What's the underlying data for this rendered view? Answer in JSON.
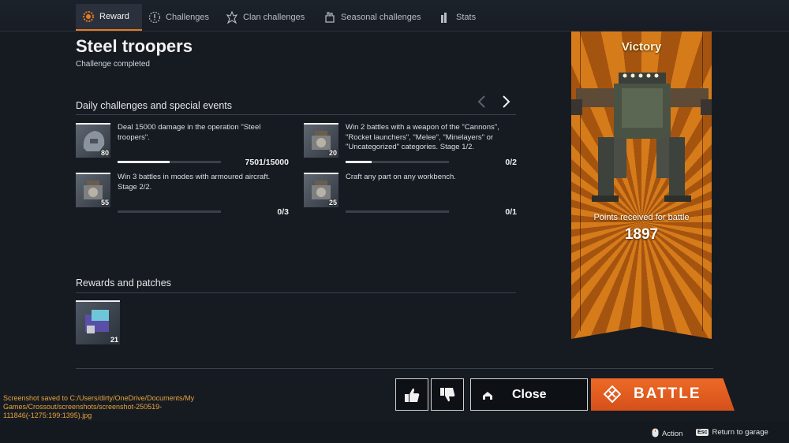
{
  "tabs": [
    {
      "label": "Reward",
      "icon": "gear-badge-icon",
      "active": true
    },
    {
      "label": "Challenges",
      "icon": "challenge-circle-icon",
      "active": false
    },
    {
      "label": "Clan challenges",
      "icon": "clan-flame-icon",
      "active": false
    },
    {
      "label": "Seasonal challenges",
      "icon": "seasonal-hand-icon",
      "active": false
    },
    {
      "label": "Stats",
      "icon": "stats-flag-icon",
      "active": false
    }
  ],
  "header": {
    "title": "Steel troopers",
    "subtitle": "Challenge completed"
  },
  "daily": {
    "heading": "Daily challenges and special events",
    "challenges": [
      {
        "text": "Deal 15000 damage in the operation \"Steel troopers\".",
        "count": "80",
        "progress": "7501/15000",
        "fraction": 0.5,
        "icon": "helmet-icon"
      },
      {
        "text": "Win 2 battles with a weapon of the \"Cannons\", \"Rocket launchers\", \"Melee\", \"Minelayers\" or \"Uncategorized\" categories. Stage 1/2.",
        "count": "20",
        "progress": "0/2",
        "fraction": 0.25,
        "icon": "scrap-crate-icon"
      },
      {
        "text": "Win 3 battles in modes with armoured aircraft. Stage 2/2.",
        "count": "55",
        "progress": "0/3",
        "fraction": 0,
        "icon": "scrap-crate-icon"
      },
      {
        "text": "Craft any part on any workbench.",
        "count": "25",
        "progress": "0/1",
        "fraction": 0,
        "icon": "scrap-crate-icon"
      }
    ]
  },
  "rewards": {
    "heading": "Rewards and patches",
    "items": [
      {
        "count": "21",
        "icon": "cargo-crate-icon"
      }
    ]
  },
  "banner": {
    "result": "Victory",
    "points_label": "Points received for battle",
    "points_value": "1897"
  },
  "actions": {
    "close_label": "Close",
    "battle_label": "BATTLE"
  },
  "screenshot_message": "Screenshot saved to C:/Users/dirty/OneDrive/Documents/My Games/Crossout/screenshots/screenshot-250519-111846(-1275:199:1395).jpg",
  "footer": {
    "action_label": "Action",
    "return_key": "Esc",
    "return_label": "Return to garage"
  },
  "colors": {
    "accent": "#e77a1f",
    "battle": "#e0581e",
    "banner": "#d67b1a",
    "message": "#e8a33a"
  }
}
